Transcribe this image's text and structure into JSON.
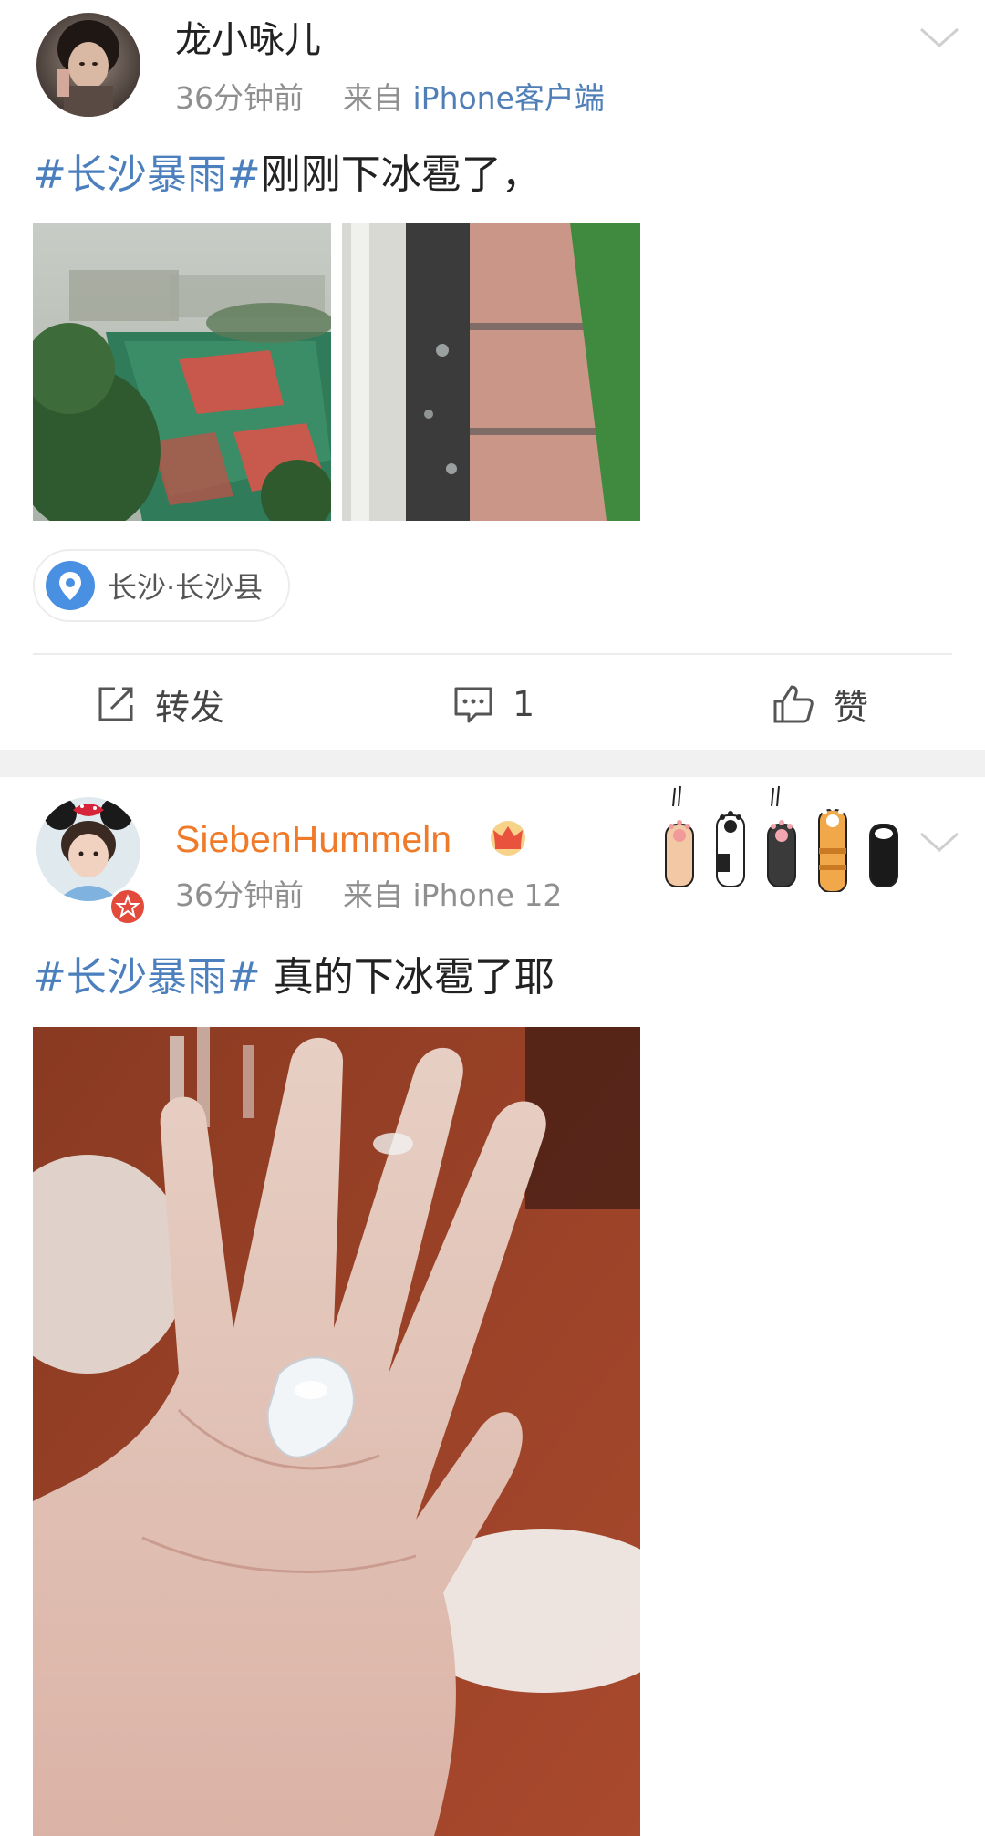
{
  "post1": {
    "username": "龙小咏儿",
    "time": "36分钟前",
    "from": "来自",
    "source": "iPhone客户端",
    "hashtag": "#长沙暴雨#",
    "text": "刚刚下冰雹了，",
    "location": "长沙·长沙县",
    "actions": {
      "repost": "转发",
      "comments": "1",
      "like": "赞"
    }
  },
  "post2": {
    "username": "SiebenHummeln",
    "time": "36分钟前",
    "from": "来自",
    "source": "iPhone 12",
    "hashtag": "#长沙暴雨#",
    "text": " 真的下冰雹了耶"
  },
  "colors": {
    "link_blue": "#4b7fbd",
    "vip_orange": "#ef7a2a",
    "meta_gray": "#8f8f8f",
    "location_pin": "#4a90e2"
  },
  "icons": {
    "post_menu": "chevron-down-icon",
    "location": "location-pin-icon",
    "repost": "repost-icon",
    "comment": "comment-icon",
    "like": "thumbs-up-icon",
    "vip": "crown-icon",
    "verified": "verified-badge-icon",
    "decoration": "cat-paws-decoration"
  }
}
